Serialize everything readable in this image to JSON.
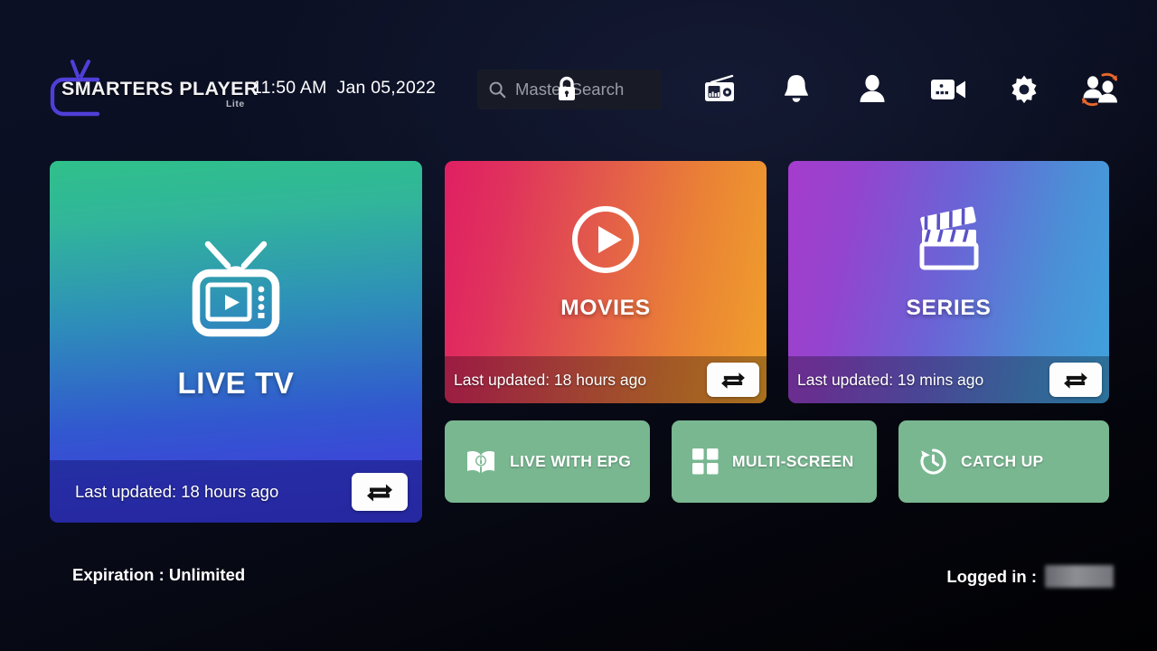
{
  "header": {
    "logo_text": "SMARTERS PLAYER",
    "logo_sub": "Lite",
    "logo_icon": "tv-outline-icon",
    "time": "11:50 AM",
    "date": "Jan 05,2022",
    "search": {
      "placeholder": "Master Search",
      "icon": "search-icon",
      "lock_icon": "lock-icon"
    },
    "icons": [
      {
        "name": "radio-icon",
        "label": "Radio"
      },
      {
        "name": "bell-icon",
        "label": "Notifications"
      },
      {
        "name": "user-icon",
        "label": "Account"
      },
      {
        "name": "video-camera-icon",
        "label": "Recordings"
      },
      {
        "name": "gear-icon",
        "label": "Settings"
      },
      {
        "name": "switch-user-icon",
        "label": "Switch User"
      }
    ]
  },
  "cards": {
    "live_tv": {
      "title": "LIVE TV",
      "icon": "tv-play-icon",
      "last_updated": "Last updated: 18 hours ago",
      "refresh_icon": "refresh-loop-icon",
      "gradient_from": "#2fc08a",
      "gradient_to": "#3b3fd4"
    },
    "movies": {
      "title": "MOVIES",
      "icon": "play-circle-icon",
      "last_updated": "Last updated: 18 hours ago",
      "refresh_icon": "refresh-loop-icon",
      "gradient_from": "#e01f63",
      "gradient_to": "#f0a02b"
    },
    "series": {
      "title": "SERIES",
      "icon": "clapperboard-icon",
      "last_updated": "Last updated: 19 mins ago",
      "refresh_icon": "refresh-loop-icon",
      "gradient_from": "#a63ccd",
      "gradient_to": "#3fa3dd"
    }
  },
  "tiles": {
    "color": "#79b791",
    "items": [
      {
        "label": "LIVE WITH EPG",
        "icon": "book-info-icon"
      },
      {
        "label": "MULTI-SCREEN",
        "icon": "grid-four-icon"
      },
      {
        "label": "CATCH UP",
        "icon": "clock-history-icon"
      }
    ]
  },
  "statusbar": {
    "expiration": "Expiration : Unlimited",
    "logged_in_label": "Logged in :",
    "logged_in_user": ""
  }
}
